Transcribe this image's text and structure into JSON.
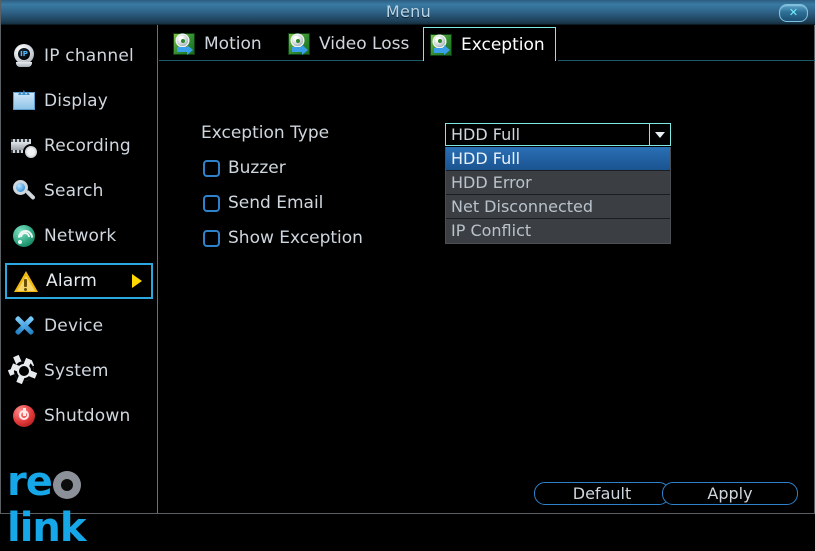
{
  "window": {
    "title": "Menu",
    "close_label": "✕"
  },
  "sidebar": {
    "items": [
      {
        "label": "IP channel",
        "icon": "ip-camera-icon",
        "selected": false
      },
      {
        "label": "Display",
        "icon": "display-icon",
        "selected": false
      },
      {
        "label": "Recording",
        "icon": "recording-icon",
        "selected": false
      },
      {
        "label": "Search",
        "icon": "search-icon",
        "selected": false
      },
      {
        "label": "Network",
        "icon": "network-icon",
        "selected": false
      },
      {
        "label": "Alarm",
        "icon": "alarm-warning-icon",
        "selected": true
      },
      {
        "label": "Device",
        "icon": "device-tools-icon",
        "selected": false
      },
      {
        "label": "System",
        "icon": "system-gear-icon",
        "selected": false
      },
      {
        "label": "Shutdown",
        "icon": "power-icon",
        "selected": false
      }
    ],
    "logo": {
      "pre": "re",
      "mid": "o",
      "post": "link"
    }
  },
  "tabs": [
    {
      "label": "Motion",
      "icon": "settings-arrow-icon",
      "active": false
    },
    {
      "label": "Video Loss",
      "icon": "settings-arrow-icon",
      "active": false
    },
    {
      "label": "Exception",
      "icon": "settings-arrow-icon",
      "active": true
    }
  ],
  "form": {
    "exception_type_label": "Exception Type",
    "checkboxes": [
      {
        "label": "Buzzer",
        "checked": false
      },
      {
        "label": "Send Email",
        "checked": false
      },
      {
        "label": "Show Exception",
        "checked": false
      }
    ],
    "dropdown": {
      "value": "HDD Full",
      "open": true,
      "options": [
        {
          "label": "HDD Full",
          "selected": true
        },
        {
          "label": "HDD Error",
          "selected": false
        },
        {
          "label": "Net Disconnected",
          "selected": false
        },
        {
          "label": "IP Conflict",
          "selected": false
        }
      ]
    }
  },
  "footer": {
    "default_label": "Default",
    "apply_label": "Apply"
  },
  "colors": {
    "accent_cyan": "#7fe9e3",
    "select_blue": "#2a6fb5",
    "sidebar_selected_border": "#2ba8e0",
    "arrow_yellow": "#ffd800",
    "logo_blue": "#15a7e8"
  }
}
